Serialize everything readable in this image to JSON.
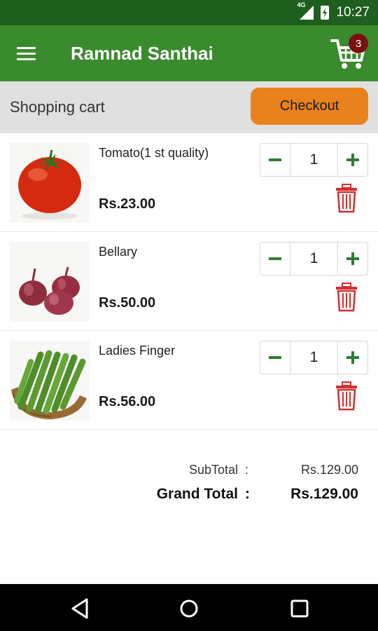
{
  "status_bar": {
    "network": "4G",
    "time": "10:27"
  },
  "app_bar": {
    "title": "Ramnad Santhai",
    "cart_count": "3"
  },
  "cart_header": {
    "title": "Shopping cart",
    "checkout_label": "Checkout"
  },
  "items": [
    {
      "name": "Tomato(1 st quality)",
      "price": "Rs.23.00",
      "qty": "1",
      "icon": "tomato-image"
    },
    {
      "name": "Bellary",
      "price": "Rs.50.00",
      "qty": "1",
      "icon": "onion-image"
    },
    {
      "name": "Ladies Finger",
      "price": "Rs.56.00",
      "qty": "1",
      "icon": "okra-image"
    }
  ],
  "totals": {
    "subtotal_label": "SubTotal",
    "subtotal_value": "Rs.129.00",
    "grand_label": "Grand Total",
    "grand_value": "Rs.129.00",
    "separator": ":"
  },
  "colors": {
    "status_bar": "#1e5e1e",
    "app_bar": "#3a8a2e",
    "checkout": "#e9821d",
    "badge": "#7a1010",
    "delete": "#d32f2f",
    "stepper_icon": "#2e7d32"
  }
}
